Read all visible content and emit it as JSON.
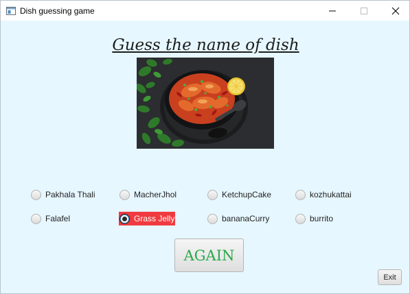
{
  "window": {
    "title": "Dish guessing game",
    "minimize_glyph": "—",
    "maximize_glyph": "☐",
    "close_glyph": "✕"
  },
  "heading": "Guess the name of dish",
  "image": {
    "icon": "dish-photo"
  },
  "options": [
    {
      "label": "Pakhala Thali",
      "selected": false
    },
    {
      "label": "MacherJhol",
      "selected": false
    },
    {
      "label": "KetchupCake",
      "selected": false
    },
    {
      "label": "kozhukattai",
      "selected": false
    },
    {
      "label": "Falafel",
      "selected": false
    },
    {
      "label": "Grass Jelly",
      "selected": true
    },
    {
      "label": "bananaCurry",
      "selected": false
    },
    {
      "label": "burrito",
      "selected": false
    }
  ],
  "buttons": {
    "again": "AGAIN",
    "exit": "Exit"
  },
  "colors": {
    "background": "#e6f7ff",
    "selected_highlight": "#f03a3f",
    "again_text": "#2aa84a"
  }
}
